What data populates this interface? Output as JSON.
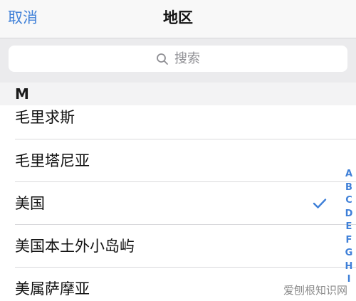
{
  "navbar": {
    "cancel_label": "取消",
    "title": "地区"
  },
  "search": {
    "placeholder": "搜索"
  },
  "section": {
    "letter": "M"
  },
  "list": {
    "items": [
      {
        "label": "毛里求斯",
        "selected": false
      },
      {
        "label": "毛里塔尼亚",
        "selected": false
      },
      {
        "label": "美国",
        "selected": true
      },
      {
        "label": "美国本土外小岛屿",
        "selected": false
      },
      {
        "label": "美属萨摩亚",
        "selected": false
      }
    ]
  },
  "index": {
    "letters": [
      "A",
      "B",
      "C",
      "D",
      "E",
      "F",
      "G",
      "H",
      "I"
    ]
  },
  "watermark": "爱刨根知识网",
  "colors": {
    "accent": "#3f80d8",
    "nav_background": "#f8f8f8",
    "search_area_background": "#ebebed",
    "section_header_background": "#f3f3f4"
  },
  "icons": {
    "search": "magnifier-icon",
    "selected": "checkmark-icon"
  }
}
